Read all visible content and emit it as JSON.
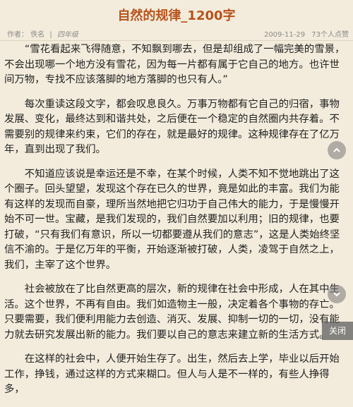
{
  "article": {
    "title": "自然的规律_1200字",
    "author_label": "作者：",
    "author": "佚名",
    "separator": "|",
    "category": "四年级",
    "date": "2009-11-29",
    "likes": "73个人点赞",
    "paragraphs": [
      "“雪花看起来飞得随意，不知飘到哪去，但是却组成了一幅完美的雪景，不会出现哪一个地方没有雪花，因为每一片都有属于它自己的地方。也许世间万物，专找不应该落脚的地方落脚的也只有人。”",
      "每次重读这段文字，都会叹息良久。万事万物都有它自己的归宿，事物发展、变化，最终达到和谐共处，之后便在一个稳定的自然圈内共存着。不需要别的规律来约束，它们的存在，就是最好的规律。这种规律存在了亿万年，直到出现了我们。",
      "不知道应该说是幸运还是不幸，在某个时候，人类不知不觉地跳出了这个圈子。回头望望，发现这个存在已久的世界，竟是如此的丰富。我们为能有这样的发现而自豪，理所当然地把它归功于自己伟大的能力，于是慢慢开始不可一世。宝藏，是我们发现的，我们自然要加以利用；旧的规律，也要打破，“只有我们有意识，所以一切都要遵从我们的意志”，这是人类始终坚信不渝的。于是亿万年的平衡，开始逐渐被打破，人类，凌驾于自然之上，我们，主宰了这个世界。",
      "社会被放在了比自然更高的层次，新的规律在社会中形成，人在其中生活。这个世界，不再有自由。我们如造物主一般，决定着各个事物的存亡。只要需要，我们便利用能力去创造、消灭、发展、抑制一切的一切，没有能力就去研究发展出新的能力。我们要以自己的意志来建立新的生活方式。",
      "在这样的社会中，人便开始生存了。出生，然后去上学，毕业以后开始工作，挣钱，通过这样的方式来糊口。但人与人是不一样的，有些人挣得多，"
    ]
  },
  "controls": {
    "scroll_up_icon": "chevron-up-icon",
    "scroll_down_icon": "chevron-down-icon",
    "close_label": "关闭"
  }
}
